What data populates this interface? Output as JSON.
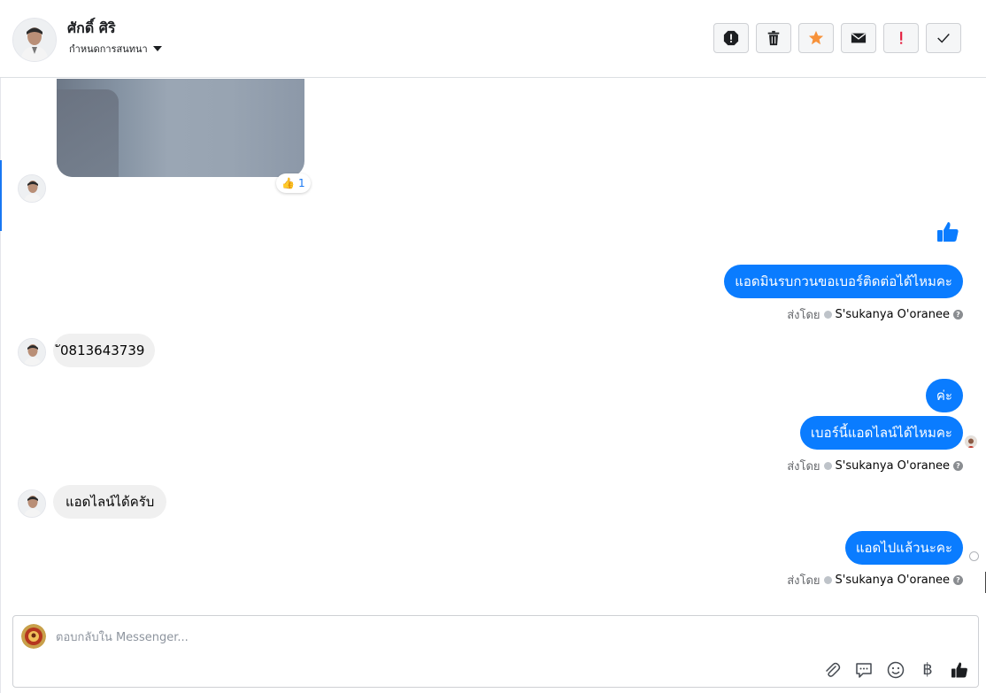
{
  "header": {
    "contact_name": "ศักดิ์ ศิริ",
    "subtitle": "กำหนดการสนทนา",
    "toolbar": [
      {
        "icon": "alert-octagon-icon"
      },
      {
        "icon": "trash-icon"
      },
      {
        "icon": "star-icon"
      },
      {
        "icon": "envelope-icon"
      },
      {
        "icon": "exclamation-icon"
      },
      {
        "icon": "check-icon"
      }
    ]
  },
  "messages": {
    "photo_reaction": {
      "emoji": "👍",
      "count": "1"
    },
    "m1_out": "แอดมินรบกวนขอเบอร์ติดต่อได้ไหมคะ",
    "sent_label": "ส่งโดย",
    "sender": "S'sukanya O'oranee",
    "m2_in": "ั0813643739",
    "m3_out": "ค่ะ",
    "m4_out": "เบอร์นี้แอดไลน์ได้ไหมคะ",
    "m5_in": "แอดไลน์ได้ครับ",
    "m6_out": "แอดไปแล้วนะคะ"
  },
  "composer": {
    "placeholder": "ตอบกลับใน Messenger...",
    "tools": [
      "paperclip-icon",
      "chat-bubble-icon",
      "smiley-icon",
      "baht-icon",
      "thumbs-up-icon"
    ],
    "baht_symbol": "฿"
  },
  "colors": {
    "outgoing_bubble": "#0a7cff",
    "incoming_bubble": "#f0f0f0",
    "star": "#f7923a",
    "alert_red": "#e41e3f",
    "active_bar": "#1877f2"
  }
}
